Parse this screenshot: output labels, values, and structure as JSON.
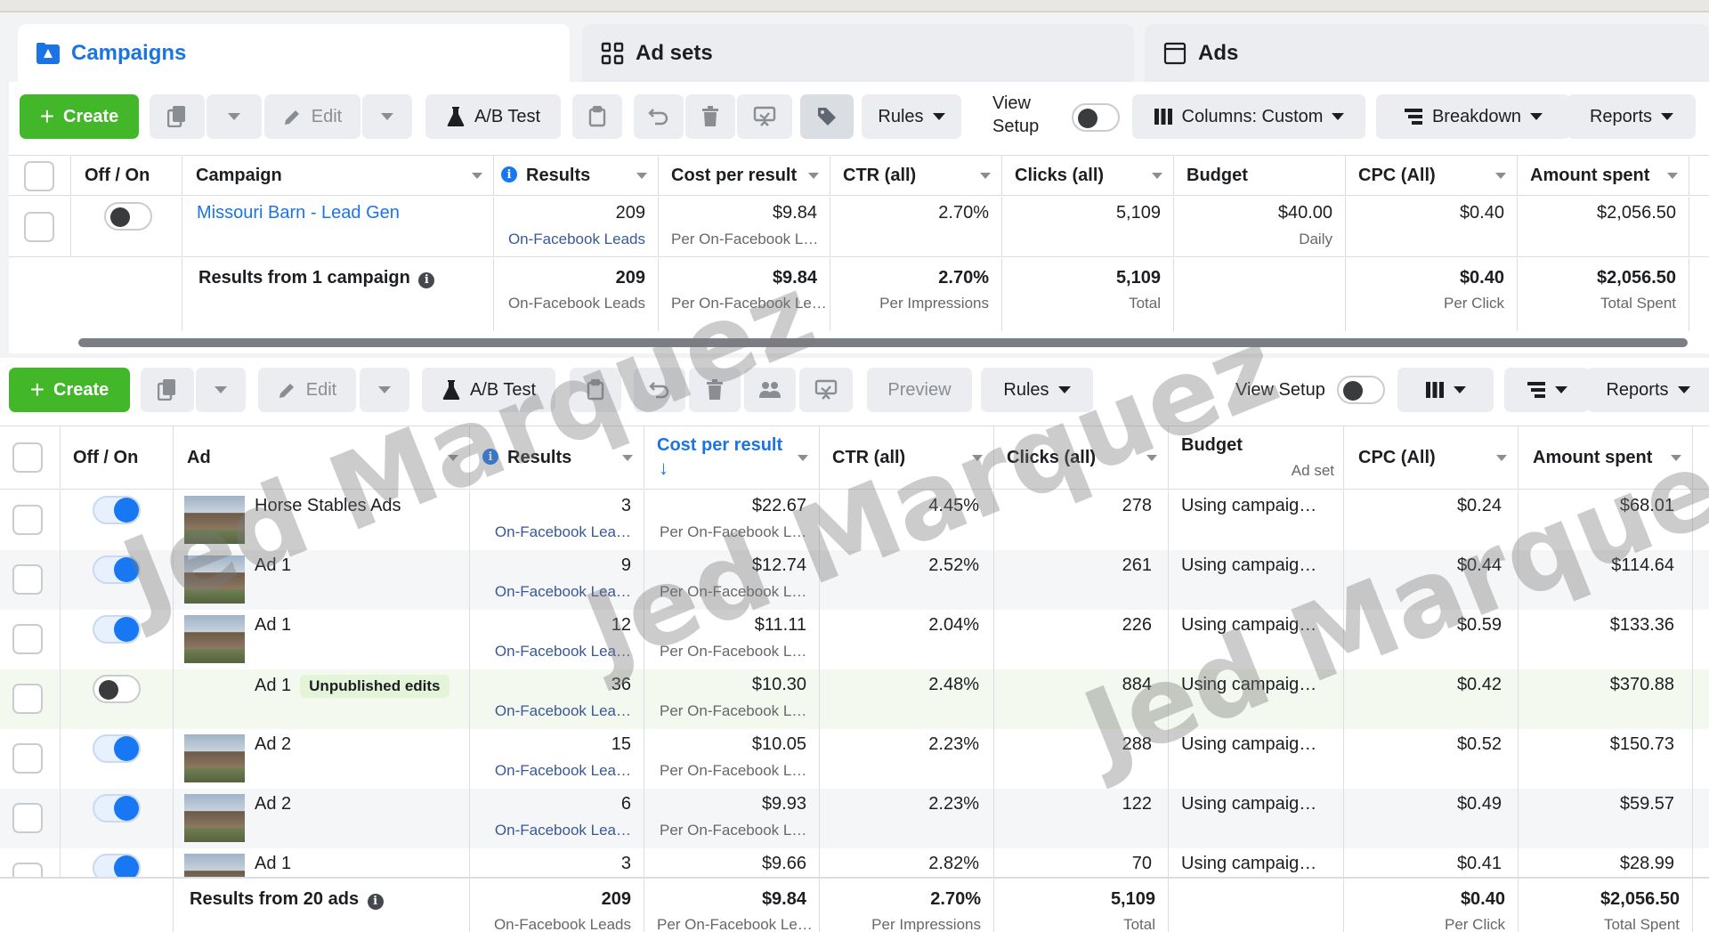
{
  "tabs": [
    {
      "label": "Campaigns",
      "icon": "folder-icon"
    },
    {
      "label": "Ad sets",
      "icon": "grid-icon"
    },
    {
      "label": "Ads",
      "icon": "window-icon"
    }
  ],
  "campaign_toolbar": {
    "create": "Create",
    "edit": "Edit",
    "ab_test": "A/B Test",
    "rules": "Rules",
    "view_setup_line1": "View",
    "view_setup_line2": "Setup",
    "columns": "Columns: Custom",
    "breakdown": "Breakdown",
    "reports": "Reports"
  },
  "campaign_table": {
    "headers": [
      "Off / On",
      "Campaign",
      "Results",
      "Cost per result",
      "CTR (all)",
      "Clicks (all)",
      "Budget",
      "CPC (All)",
      "Amount spent"
    ],
    "row": {
      "name": "Missouri Barn - Lead Gen",
      "results": "209",
      "results_sub": "On-Facebook Leads",
      "cost": "$9.84",
      "cost_sub": "Per On-Facebook L…",
      "ctr": "2.70%",
      "clicks": "5,109",
      "budget": "$40.00",
      "budget_sub": "Daily",
      "cpc": "$0.40",
      "spent": "$2,056.50"
    },
    "summary": {
      "label": "Results from 1 campaign",
      "results": "209",
      "results_sub": "On-Facebook Leads",
      "cost": "$9.84",
      "cost_sub": "Per On-Facebook Le…",
      "ctr": "2.70%",
      "ctr_sub": "Per Impressions",
      "clicks": "5,109",
      "clicks_sub": "Total",
      "cpc": "$0.40",
      "cpc_sub": "Per Click",
      "spent": "$2,056.50",
      "spent_sub": "Total Spent"
    }
  },
  "ads_toolbar": {
    "create": "Create",
    "edit": "Edit",
    "ab_test": "A/B Test",
    "preview": "Preview",
    "rules": "Rules",
    "view_setup": "View Setup",
    "reports": "Reports"
  },
  "ads_table": {
    "headers": {
      "onoff": "Off / On",
      "ad": "Ad",
      "results": "Results",
      "cost": "Cost per result",
      "ctr": "CTR (all)",
      "clicks": "Clicks (all)",
      "budget": "Budget",
      "budget_sub": "Ad set",
      "cpc": "CPC (All)",
      "spent": "Amount spent"
    },
    "rows": [
      {
        "name": "Horse Stables Ads",
        "on": true,
        "thumb": true,
        "badge": "",
        "results": "3",
        "results_sub": "On-Facebook Lea…",
        "cost": "$22.67",
        "cost_sub": "Per On-Facebook L…",
        "ctr": "4.45%",
        "clicks": "278",
        "budget": "Using campaig…",
        "cpc": "$0.24",
        "spent": "$68.01"
      },
      {
        "name": "Ad 1",
        "on": true,
        "thumb": true,
        "badge": "",
        "results": "9",
        "results_sub": "On-Facebook Lea…",
        "cost": "$12.74",
        "cost_sub": "Per On-Facebook L…",
        "ctr": "2.52%",
        "clicks": "261",
        "budget": "Using campaig…",
        "cpc": "$0.44",
        "spent": "$114.64"
      },
      {
        "name": "Ad 1",
        "on": true,
        "thumb": true,
        "badge": "",
        "results": "12",
        "results_sub": "On-Facebook Lea…",
        "cost": "$11.11",
        "cost_sub": "Per On-Facebook L…",
        "ctr": "2.04%",
        "clicks": "226",
        "budget": "Using campaig…",
        "cpc": "$0.59",
        "spent": "$133.36"
      },
      {
        "name": "Ad 1",
        "on": false,
        "thumb": false,
        "badge": "Unpublished edits",
        "results": "36",
        "results_sub": "On-Facebook Lea…",
        "cost": "$10.30",
        "cost_sub": "Per On-Facebook L…",
        "ctr": "2.48%",
        "clicks": "884",
        "budget": "Using campaig…",
        "cpc": "$0.42",
        "spent": "$370.88"
      },
      {
        "name": "Ad 2",
        "on": true,
        "thumb": true,
        "badge": "",
        "results": "15",
        "results_sub": "On-Facebook Lea…",
        "cost": "$10.05",
        "cost_sub": "Per On-Facebook L…",
        "ctr": "2.23%",
        "clicks": "288",
        "budget": "Using campaig…",
        "cpc": "$0.52",
        "spent": "$150.73"
      },
      {
        "name": "Ad 2",
        "on": true,
        "thumb": true,
        "badge": "",
        "results": "6",
        "results_sub": "On-Facebook Lea…",
        "cost": "$9.93",
        "cost_sub": "Per On-Facebook L…",
        "ctr": "2.23%",
        "clicks": "122",
        "budget": "Using campaig…",
        "cpc": "$0.49",
        "spent": "$59.57"
      },
      {
        "name": "Ad 1",
        "on": true,
        "thumb": true,
        "badge": "",
        "results": "3",
        "results_sub": "",
        "cost": "$9.66",
        "cost_sub": "",
        "ctr": "2.82%",
        "clicks": "70",
        "budget": "Using campaig…",
        "cpc": "$0.41",
        "spent": "$28.99"
      }
    ],
    "summary": {
      "label": "Results from 20 ads",
      "results": "209",
      "results_sub": "On-Facebook Leads",
      "cost": "$9.84",
      "cost_sub": "Per On-Facebook Le…",
      "ctr": "2.70%",
      "ctr_sub": "Per Impressions",
      "clicks": "5,109",
      "clicks_sub": "Total",
      "cpc": "$0.40",
      "cpc_sub": "Per Click",
      "spent": "$2,056.50",
      "spent_sub": "Total Spent"
    }
  },
  "watermark": "Jed Marquez",
  "colors": {
    "brand_blue": "#1b74e4",
    "create_green": "#42b72a",
    "toggle_on": "#1877f2"
  }
}
